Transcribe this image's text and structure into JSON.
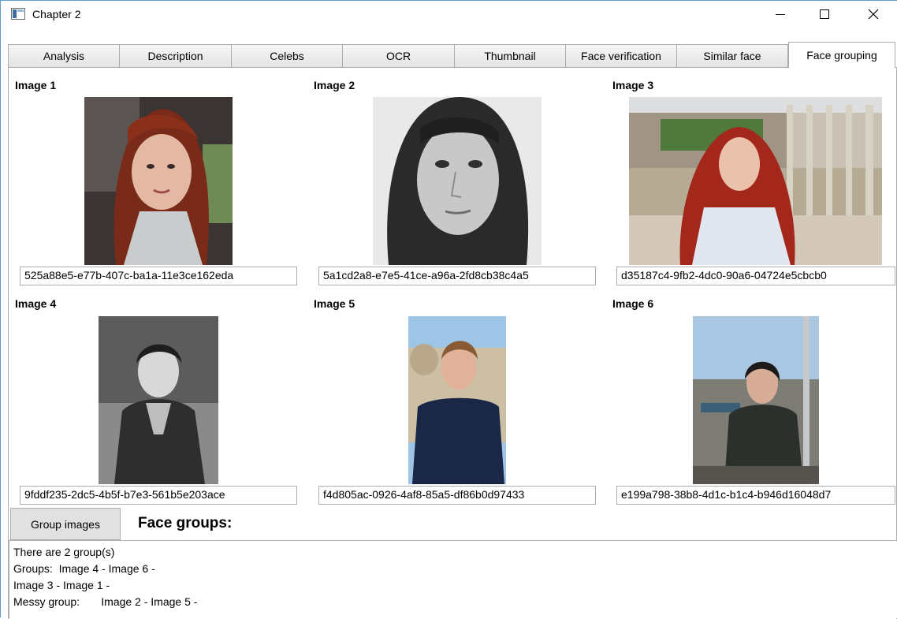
{
  "window": {
    "title": "Chapter 2",
    "minimize_label": "minimize",
    "maximize_label": "maximize",
    "close_label": "close"
  },
  "tabs": [
    {
      "label": "Analysis",
      "active": false
    },
    {
      "label": "Description",
      "active": false
    },
    {
      "label": "Celebs",
      "active": false
    },
    {
      "label": "OCR",
      "active": false
    },
    {
      "label": "Thumbnail",
      "active": false
    },
    {
      "label": "Face verification",
      "active": false
    },
    {
      "label": "Similar face",
      "active": false
    },
    {
      "label": "Face grouping",
      "active": true
    }
  ],
  "images": [
    {
      "label": "Image 1",
      "face_id": "525a88e5-e77b-407c-ba1a-11e3ce162eda"
    },
    {
      "label": "Image 2",
      "face_id": "5a1cd2a8-e7e5-41ce-a96a-2fd8cb38c4a5"
    },
    {
      "label": "Image 3",
      "face_id": "d35187c4-9fb2-4dc0-90a6-04724e5cbcb0"
    },
    {
      "label": "Image 4",
      "face_id": "9fddf235-2dc5-4b5f-b7e3-561b5e203ace"
    },
    {
      "label": "Image 5",
      "face_id": "f4d805ac-0926-4af8-85a5-df86b0d97433"
    },
    {
      "label": "Image 6",
      "face_id": "e199a798-38b8-4d1c-b1c4-b946d16048d7"
    }
  ],
  "group_button": {
    "label": "Group images"
  },
  "face_groups_heading": "Face groups:",
  "results": [
    "There are 2 group(s)",
    "Groups:  Image 4 - Image 6 -",
    "Image 3 - Image 1 -",
    "Messy group:       Image 2 - Image 5 -"
  ]
}
